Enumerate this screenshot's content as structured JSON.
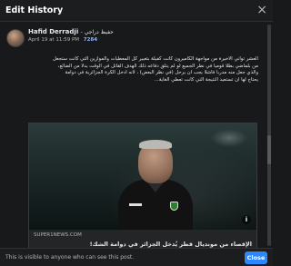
{
  "dialog": {
    "title": "Edit History",
    "close_glyph": "×",
    "close_button_label": "Close",
    "visibility_note": "This is visible to anyone who can see this post."
  },
  "post": {
    "author_name": "Hafid Derradji",
    "author_name_arabic": "- حفيظ دراجي",
    "timestamp": "April 19 at 11:59 PM",
    "likes_count": "7284",
    "body_lines": [
      "العشر تواني الأخيرة من مواجهة الكاميرون كانت كفيلة بتغيير كل المعطيات والموازين التي كانت ستجعل",
      "من بلماضي بطلاً قومياً في نظر الجميع لو لم يتلق دفاعه ذلك الهدف القاتل في الوقت بدلاً من الضائع،",
      "والذي جعل منه مدرباً فاشلاً يجب أن يرحل (في نظر البعض) ، لأنه أدخل الكرة الجزائرية في دوامة",
      "يحتاج لها أن تستعيد النتيجة التي كانت تعطي الغاية..."
    ],
    "link": {
      "domain": "SUPER1NEWS.COM",
      "title": "الإقصاء من مونديال قطر يُدخل الجزائر في دوامة الشك!",
      "info_glyph": "i"
    }
  },
  "icons": {
    "close": "close-icon",
    "info": "info-icon",
    "avatar": "avatar"
  },
  "colors": {
    "background": "#18191a",
    "accent": "#2d88ff",
    "likes": "#8ab4f8"
  }
}
